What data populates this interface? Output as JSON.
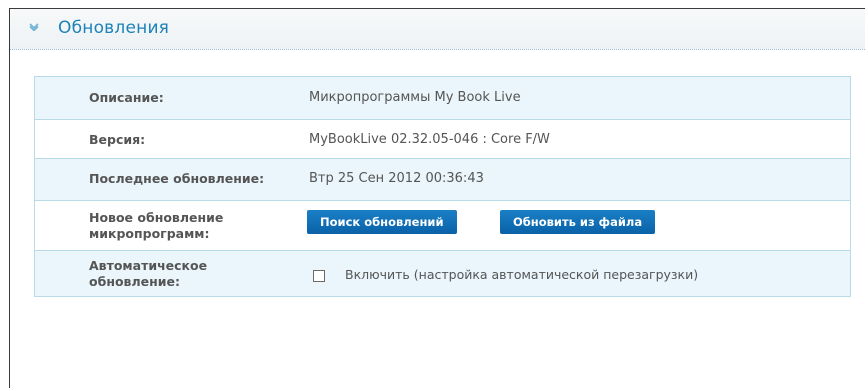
{
  "section": {
    "title": "Обновления"
  },
  "rows": {
    "description": {
      "label": "Описание:",
      "value": "Микропрограммы My Book Live"
    },
    "version": {
      "label": "Версия:",
      "value": "MyBookLive 02.32.05-046 : Core F/W"
    },
    "last_update": {
      "label": "Последнее обновление:",
      "value": "Втр 25 Сен 2012 00:36:43"
    },
    "new_update": {
      "label_line1": "Новое обновление",
      "label_line2": "микропрограмм:",
      "check_button": "Поиск обновлений",
      "file_button": "Обновить из файла"
    },
    "auto_update": {
      "label_line1": "Автоматическое",
      "label_line2": "обновление:",
      "checkbox_label": "Включить (настройка автоматической перезагрузки)",
      "checked": false
    }
  },
  "colors": {
    "accent": "#1c82b8",
    "button": "#0a62a8",
    "row_shade": "#eaf6fb",
    "border": "#b9dbe8"
  }
}
